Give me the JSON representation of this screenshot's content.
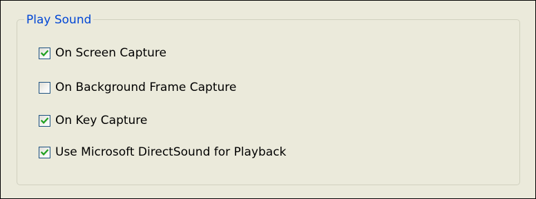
{
  "group": {
    "title": "Play Sound"
  },
  "options": [
    {
      "label": "On Screen Capture",
      "checked": true
    },
    {
      "label": "On Background Frame Capture",
      "checked": false
    },
    {
      "label": "On Key Capture",
      "checked": true
    },
    {
      "label": "Use Microsoft DirectSound for Playback",
      "checked": true
    }
  ],
  "colors": {
    "legend_text": "#0046d5",
    "check_mark": "#21a121",
    "checkbox_border": "#1c5180",
    "panel_background": "#ebeadb"
  },
  "icons": {
    "check": "check-icon"
  }
}
